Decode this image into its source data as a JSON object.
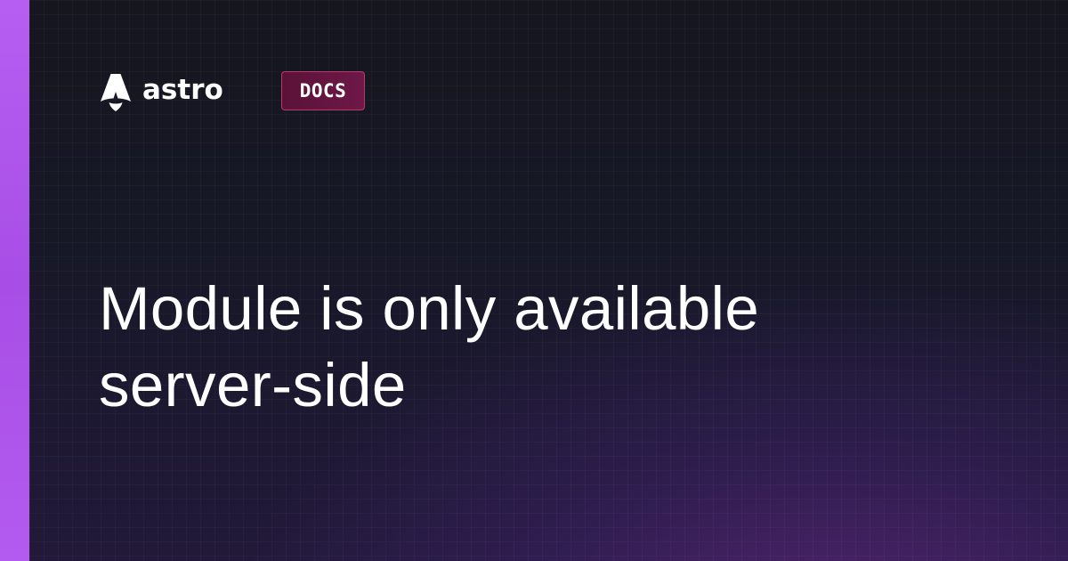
{
  "brand": {
    "wordmark": "astro",
    "logo_icon": "astro-rocket-logo-icon",
    "badge": "DOCS"
  },
  "page": {
    "title_line_1": "Module is only available",
    "title_line_2": "server-side"
  },
  "colors": {
    "background": "#13141c",
    "side_stripe": "#b65ef2",
    "badge_fill": "#6e1847",
    "badge_border": "#b8396b",
    "text": "#ffffff",
    "glow": "#762c96"
  }
}
